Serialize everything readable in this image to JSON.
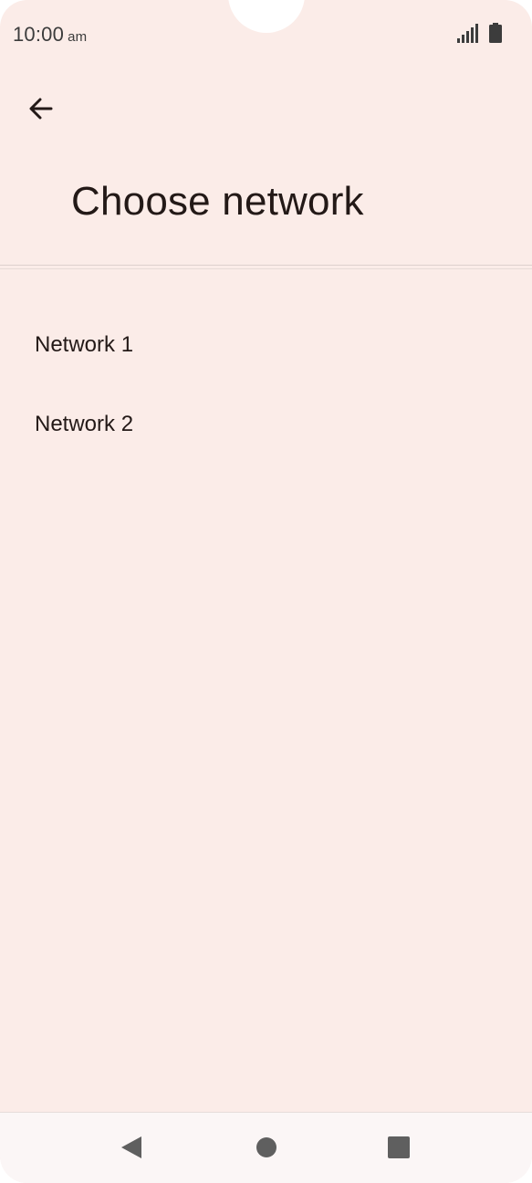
{
  "status_bar": {
    "time": "10:00",
    "ampm": "am",
    "signal_icon": "cellular-signal-icon",
    "battery_icon": "battery-full-icon"
  },
  "header": {
    "back_icon": "arrow-back-icon",
    "title": "Choose network"
  },
  "networks": [
    {
      "label": "Network 1"
    },
    {
      "label": "Network 2"
    }
  ],
  "nav_bar": {
    "back_icon": "triangle-back-icon",
    "home_icon": "circle-home-icon",
    "recents_icon": "square-recents-icon"
  },
  "colors": {
    "background": "#fbece8",
    "text": "#231917",
    "nav_background": "#fbf6f6"
  }
}
